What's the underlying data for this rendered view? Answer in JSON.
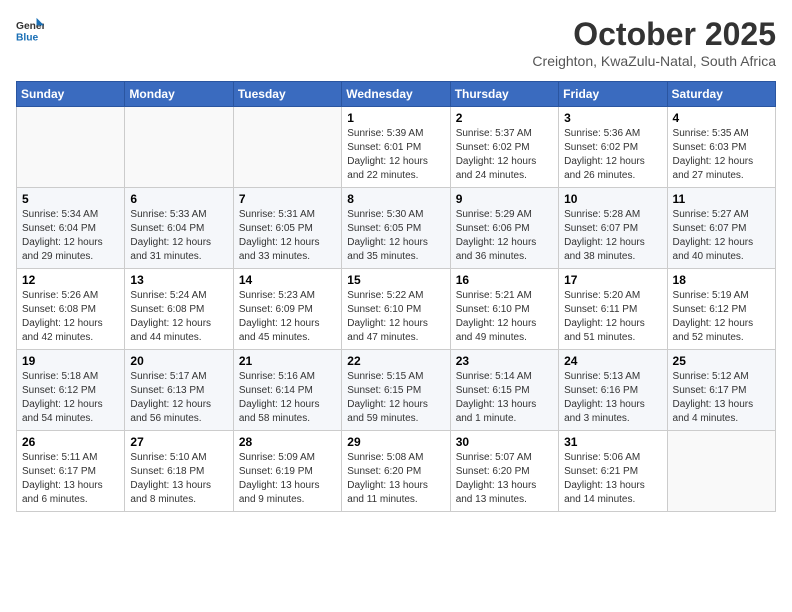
{
  "logo": {
    "line1": "General",
    "line2": "Blue"
  },
  "header": {
    "title": "October 2025",
    "subtitle": "Creighton, KwaZulu-Natal, South Africa"
  },
  "weekdays": [
    "Sunday",
    "Monday",
    "Tuesday",
    "Wednesday",
    "Thursday",
    "Friday",
    "Saturday"
  ],
  "weeks": [
    [
      {
        "day": "",
        "info": ""
      },
      {
        "day": "",
        "info": ""
      },
      {
        "day": "",
        "info": ""
      },
      {
        "day": "1",
        "info": "Sunrise: 5:39 AM\nSunset: 6:01 PM\nDaylight: 12 hours and 22 minutes."
      },
      {
        "day": "2",
        "info": "Sunrise: 5:37 AM\nSunset: 6:02 PM\nDaylight: 12 hours and 24 minutes."
      },
      {
        "day": "3",
        "info": "Sunrise: 5:36 AM\nSunset: 6:02 PM\nDaylight: 12 hours and 26 minutes."
      },
      {
        "day": "4",
        "info": "Sunrise: 5:35 AM\nSunset: 6:03 PM\nDaylight: 12 hours and 27 minutes."
      }
    ],
    [
      {
        "day": "5",
        "info": "Sunrise: 5:34 AM\nSunset: 6:04 PM\nDaylight: 12 hours and 29 minutes."
      },
      {
        "day": "6",
        "info": "Sunrise: 5:33 AM\nSunset: 6:04 PM\nDaylight: 12 hours and 31 minutes."
      },
      {
        "day": "7",
        "info": "Sunrise: 5:31 AM\nSunset: 6:05 PM\nDaylight: 12 hours and 33 minutes."
      },
      {
        "day": "8",
        "info": "Sunrise: 5:30 AM\nSunset: 6:05 PM\nDaylight: 12 hours and 35 minutes."
      },
      {
        "day": "9",
        "info": "Sunrise: 5:29 AM\nSunset: 6:06 PM\nDaylight: 12 hours and 36 minutes."
      },
      {
        "day": "10",
        "info": "Sunrise: 5:28 AM\nSunset: 6:07 PM\nDaylight: 12 hours and 38 minutes."
      },
      {
        "day": "11",
        "info": "Sunrise: 5:27 AM\nSunset: 6:07 PM\nDaylight: 12 hours and 40 minutes."
      }
    ],
    [
      {
        "day": "12",
        "info": "Sunrise: 5:26 AM\nSunset: 6:08 PM\nDaylight: 12 hours and 42 minutes."
      },
      {
        "day": "13",
        "info": "Sunrise: 5:24 AM\nSunset: 6:08 PM\nDaylight: 12 hours and 44 minutes."
      },
      {
        "day": "14",
        "info": "Sunrise: 5:23 AM\nSunset: 6:09 PM\nDaylight: 12 hours and 45 minutes."
      },
      {
        "day": "15",
        "info": "Sunrise: 5:22 AM\nSunset: 6:10 PM\nDaylight: 12 hours and 47 minutes."
      },
      {
        "day": "16",
        "info": "Sunrise: 5:21 AM\nSunset: 6:10 PM\nDaylight: 12 hours and 49 minutes."
      },
      {
        "day": "17",
        "info": "Sunrise: 5:20 AM\nSunset: 6:11 PM\nDaylight: 12 hours and 51 minutes."
      },
      {
        "day": "18",
        "info": "Sunrise: 5:19 AM\nSunset: 6:12 PM\nDaylight: 12 hours and 52 minutes."
      }
    ],
    [
      {
        "day": "19",
        "info": "Sunrise: 5:18 AM\nSunset: 6:12 PM\nDaylight: 12 hours and 54 minutes."
      },
      {
        "day": "20",
        "info": "Sunrise: 5:17 AM\nSunset: 6:13 PM\nDaylight: 12 hours and 56 minutes."
      },
      {
        "day": "21",
        "info": "Sunrise: 5:16 AM\nSunset: 6:14 PM\nDaylight: 12 hours and 58 minutes."
      },
      {
        "day": "22",
        "info": "Sunrise: 5:15 AM\nSunset: 6:15 PM\nDaylight: 12 hours and 59 minutes."
      },
      {
        "day": "23",
        "info": "Sunrise: 5:14 AM\nSunset: 6:15 PM\nDaylight: 13 hours and 1 minute."
      },
      {
        "day": "24",
        "info": "Sunrise: 5:13 AM\nSunset: 6:16 PM\nDaylight: 13 hours and 3 minutes."
      },
      {
        "day": "25",
        "info": "Sunrise: 5:12 AM\nSunset: 6:17 PM\nDaylight: 13 hours and 4 minutes."
      }
    ],
    [
      {
        "day": "26",
        "info": "Sunrise: 5:11 AM\nSunset: 6:17 PM\nDaylight: 13 hours and 6 minutes."
      },
      {
        "day": "27",
        "info": "Sunrise: 5:10 AM\nSunset: 6:18 PM\nDaylight: 13 hours and 8 minutes."
      },
      {
        "day": "28",
        "info": "Sunrise: 5:09 AM\nSunset: 6:19 PM\nDaylight: 13 hours and 9 minutes."
      },
      {
        "day": "29",
        "info": "Sunrise: 5:08 AM\nSunset: 6:20 PM\nDaylight: 13 hours and 11 minutes."
      },
      {
        "day": "30",
        "info": "Sunrise: 5:07 AM\nSunset: 6:20 PM\nDaylight: 13 hours and 13 minutes."
      },
      {
        "day": "31",
        "info": "Sunrise: 5:06 AM\nSunset: 6:21 PM\nDaylight: 13 hours and 14 minutes."
      },
      {
        "day": "",
        "info": ""
      }
    ]
  ]
}
